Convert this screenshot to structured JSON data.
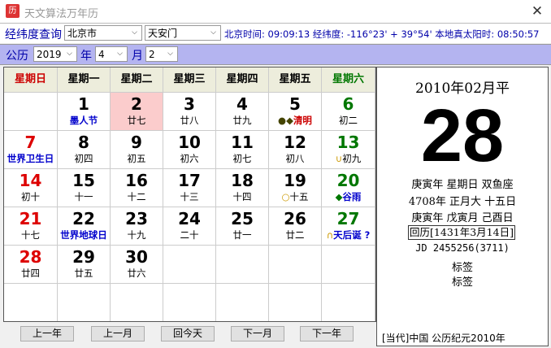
{
  "window": {
    "title": "天文算法万年历"
  },
  "location": {
    "label": "经纬度查询",
    "city": "北京市",
    "district": "天安门",
    "info": "北京时间: 09:09:13 经纬度: -116°23' + 39°54' 本地真太阳时: 08:50:57"
  },
  "date_select": {
    "calendar_label": "公历",
    "year": "2019",
    "year_label": "年",
    "month": "4",
    "month_label": "月",
    "day": "2"
  },
  "calendar": {
    "weekdays": [
      {
        "label": "星期日",
        "color": "#cc0000"
      },
      {
        "label": "星期一",
        "color": "#000000"
      },
      {
        "label": "星期二",
        "color": "#000000"
      },
      {
        "label": "星期三",
        "color": "#000000"
      },
      {
        "label": "星期四",
        "color": "#000000"
      },
      {
        "label": "星期五",
        "color": "#000000"
      },
      {
        "label": "星期六",
        "color": "#007700"
      }
    ],
    "weeks": [
      [
        null,
        {
          "day": "1",
          "sub": "墨人节",
          "day_color": "#000000",
          "sub_color": "#0000cc",
          "sub_bold": true
        },
        {
          "day": "2",
          "sub": "廿七",
          "day_color": "#000000",
          "sub_color": "#000000",
          "today": true
        },
        {
          "day": "3",
          "sub": "廿八",
          "day_color": "#000000",
          "sub_color": "#000000"
        },
        {
          "day": "4",
          "sub": "廿九",
          "day_color": "#000000",
          "sub_color": "#000000"
        },
        {
          "day": "5",
          "sub": "清明",
          "prefix": "●◆",
          "prefix_color": "#444400",
          "day_color": "#000000",
          "sub_color": "#cc0000",
          "sub_bold": true
        },
        {
          "day": "6",
          "sub": "初二",
          "day_color": "#007700",
          "sub_color": "#000000"
        }
      ],
      [
        {
          "day": "7",
          "sub": "世界卫生日",
          "day_color": "#dd0000",
          "sub_color": "#0000cc",
          "sub_bold": true
        },
        {
          "day": "8",
          "sub": "初四",
          "day_color": "#000000",
          "sub_color": "#000000"
        },
        {
          "day": "9",
          "sub": "初五",
          "day_color": "#000000",
          "sub_color": "#000000"
        },
        {
          "day": "10",
          "sub": "初六",
          "day_color": "#000000",
          "sub_color": "#000000"
        },
        {
          "day": "11",
          "sub": "初七",
          "day_color": "#000000",
          "sub_color": "#000000"
        },
        {
          "day": "12",
          "sub": "初八",
          "day_color": "#000000",
          "sub_color": "#000000"
        },
        {
          "day": "13",
          "sub": "初九",
          "prefix": "∪",
          "prefix_color": "#cc9900",
          "day_color": "#007700",
          "sub_color": "#000000"
        }
      ],
      [
        {
          "day": "14",
          "sub": "初十",
          "day_color": "#dd0000",
          "sub_color": "#000000"
        },
        {
          "day": "15",
          "sub": "十一",
          "day_color": "#000000",
          "sub_color": "#000000"
        },
        {
          "day": "16",
          "sub": "十二",
          "day_color": "#000000",
          "sub_color": "#000000"
        },
        {
          "day": "17",
          "sub": "十三",
          "day_color": "#000000",
          "sub_color": "#000000"
        },
        {
          "day": "18",
          "sub": "十四",
          "day_color": "#000000",
          "sub_color": "#000000"
        },
        {
          "day": "19",
          "sub": "十五",
          "prefix": "○",
          "prefix_color": "#cc9900",
          "day_color": "#000000",
          "sub_color": "#000000"
        },
        {
          "day": "20",
          "sub": "谷雨",
          "prefix": "◆",
          "prefix_color": "#007700",
          "day_color": "#007700",
          "sub_color": "#0000cc",
          "sub_bold": true
        }
      ],
      [
        {
          "day": "21",
          "sub": "十七",
          "day_color": "#dd0000",
          "sub_color": "#000000"
        },
        {
          "day": "22",
          "sub": "世界地球日",
          "day_color": "#000000",
          "sub_color": "#0000cc",
          "sub_bold": true
        },
        {
          "day": "23",
          "sub": "十九",
          "day_color": "#000000",
          "sub_color": "#000000"
        },
        {
          "day": "24",
          "sub": "二十",
          "day_color": "#000000",
          "sub_color": "#000000"
        },
        {
          "day": "25",
          "sub": "廿一",
          "day_color": "#000000",
          "sub_color": "#000000"
        },
        {
          "day": "26",
          "sub": "廿二",
          "day_color": "#000000",
          "sub_color": "#000000"
        },
        {
          "day": "27",
          "sub": "天后诞 ?",
          "prefix": "∩",
          "prefix_color": "#cc9900",
          "day_color": "#007700",
          "sub_color": "#0000cc",
          "sub_bold": true
        }
      ],
      [
        {
          "day": "28",
          "sub": "廿四",
          "day_color": "#dd0000",
          "sub_color": "#000000"
        },
        {
          "day": "29",
          "sub": "廿五",
          "day_color": "#000000",
          "sub_color": "#000000"
        },
        {
          "day": "30",
          "sub": "廿六",
          "day_color": "#000000",
          "sub_color": "#000000"
        },
        null,
        null,
        null,
        null
      ],
      [
        null,
        null,
        null,
        null,
        null,
        null,
        null
      ]
    ]
  },
  "buttons": {
    "prev_year": "上一年",
    "prev_month": "上一月",
    "today": "回今天",
    "next_month": "下一月",
    "next_year": "下一年"
  },
  "detail": {
    "title": "2010年02月平",
    "day": "28",
    "line1": "庚寅年 星期日 双鱼座",
    "line2": "4708年 正月大 十五日",
    "line3": "庚寅年 戊寅月 己酉日",
    "hijri": "回历[1431年3月14日]",
    "jd": "JD 2455256(3711)",
    "tag1": "标签",
    "tag2": "标签",
    "footer": "[当代]中国  公历纪元2010年"
  }
}
